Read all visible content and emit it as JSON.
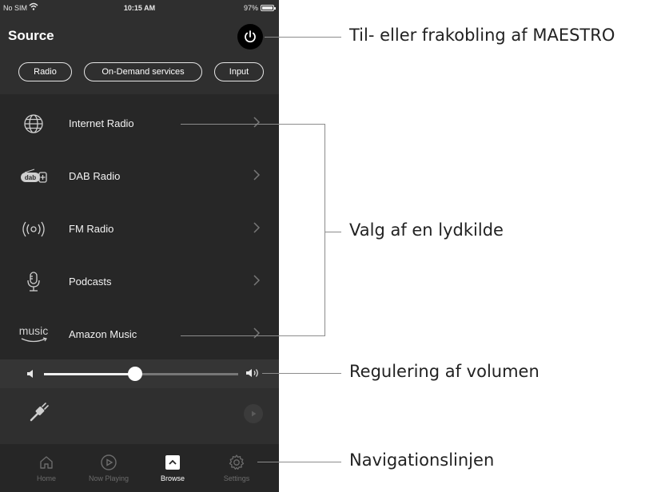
{
  "status_bar": {
    "carrier": "No SIM",
    "time": "10:15 AM",
    "battery": "97%"
  },
  "header": {
    "title": "Source",
    "power_icon": "power-icon"
  },
  "source_tabs": [
    {
      "label": "Radio"
    },
    {
      "label": "On-Demand services"
    },
    {
      "label": "Input"
    }
  ],
  "sources": [
    {
      "label": "Internet Radio",
      "icon": "globe-icon"
    },
    {
      "label": "DAB Radio",
      "icon": "dab-icon"
    },
    {
      "label": "FM Radio",
      "icon": "radio-waves-icon"
    },
    {
      "label": "Podcasts",
      "icon": "microphone-icon"
    },
    {
      "label": "Amazon Music",
      "icon": "amazon-music-icon",
      "icon_text": "music"
    }
  ],
  "volume": {
    "level": 0.47
  },
  "navigation": [
    {
      "label": "Home",
      "icon": "home-icon",
      "active": false
    },
    {
      "label": "Now Playing",
      "icon": "play-circle-icon",
      "active": false
    },
    {
      "label": "Browse",
      "icon": "browse-icon",
      "active": true
    },
    {
      "label": "Settings",
      "icon": "gear-icon",
      "active": false
    }
  ],
  "callouts": {
    "power": "Til- eller frakobling af MAESTRO",
    "source": "Valg af en lydkilde",
    "volume": "Regulering af volumen",
    "navigation": "Navigationslinjen"
  },
  "colors": {
    "background": "#2f2f2f",
    "list_bg": "#272727",
    "accent": "#ffffff",
    "callout_line": "#8c8c8c"
  }
}
